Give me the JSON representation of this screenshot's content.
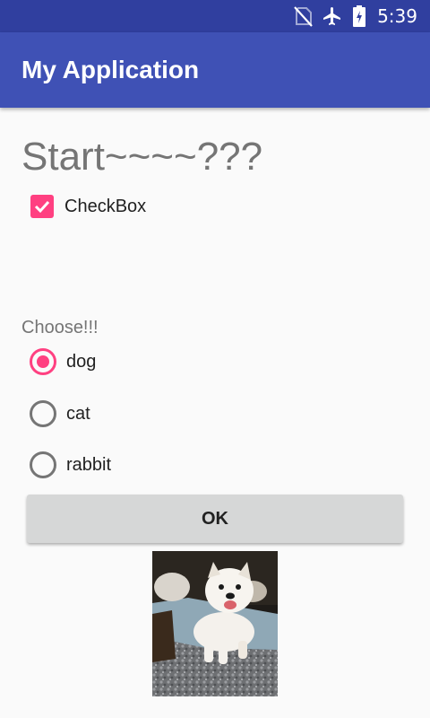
{
  "status_bar": {
    "time": "5:39",
    "icons": [
      "no-sim-icon",
      "airplane-mode-icon",
      "battery-charging-icon"
    ]
  },
  "app_bar": {
    "title": "My Application"
  },
  "main": {
    "heading": "Start~~~~???",
    "checkbox": {
      "label": "CheckBox",
      "checked": true
    },
    "radio_group": {
      "label": "Choose!!!",
      "options": [
        {
          "label": "dog",
          "selected": true
        },
        {
          "label": "cat",
          "selected": false
        },
        {
          "label": "rabbit",
          "selected": false
        }
      ]
    },
    "ok_button_label": "OK",
    "image": {
      "subject": "puppy-photo"
    }
  },
  "colors": {
    "status_bar": "#303f9f",
    "app_bar": "#3f51b5",
    "accent": "#ff4081",
    "background": "#fafafa"
  }
}
